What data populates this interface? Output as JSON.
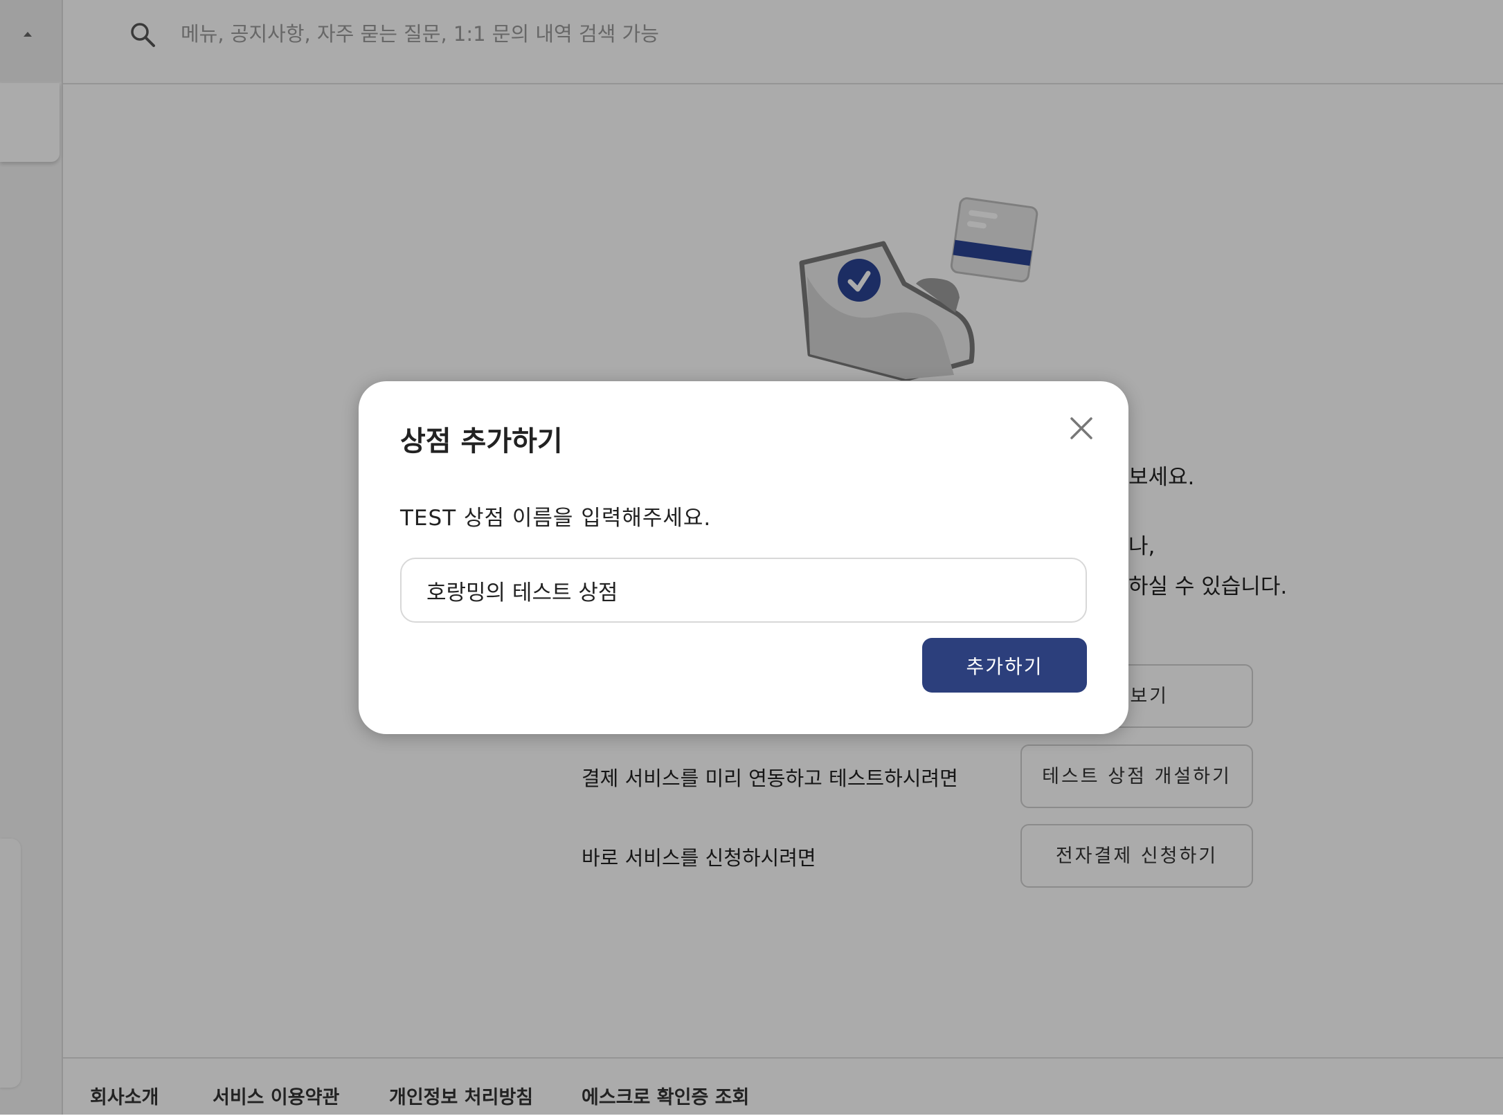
{
  "search": {
    "placeholder": "메뉴, 공지사항, 자주 묻는 질문, 1:1 문의 내역 검색 가능"
  },
  "intro": {
    "line1_tail": "보세요.",
    "line2_tail": "나,",
    "line3_tail": "하실 수 있습니다."
  },
  "actions": {
    "demo_button_tail": "보기",
    "test_text": "결제 서비스를 미리 연동하고 테스트하시려면",
    "test_button": "테스트 상점 개설하기",
    "apply_text": "바로 서비스를 신청하시려면",
    "apply_button": "전자결제 신청하기"
  },
  "footer": {
    "links": [
      "회사소개",
      "서비스 이용약관",
      "개인정보 처리방침",
      "에스크로 확인증 조회"
    ]
  },
  "modal": {
    "title": "상점 추가하기",
    "label": "TEST 상점 이름을 입력해주세요.",
    "input_value": "호랑밍의 테스트 상점",
    "submit_label": "추가하기"
  },
  "colors": {
    "primary": "#2c3f7c",
    "illustration_blue": "#2b4494",
    "overlay": "rgba(0,0,0,0.33)"
  }
}
